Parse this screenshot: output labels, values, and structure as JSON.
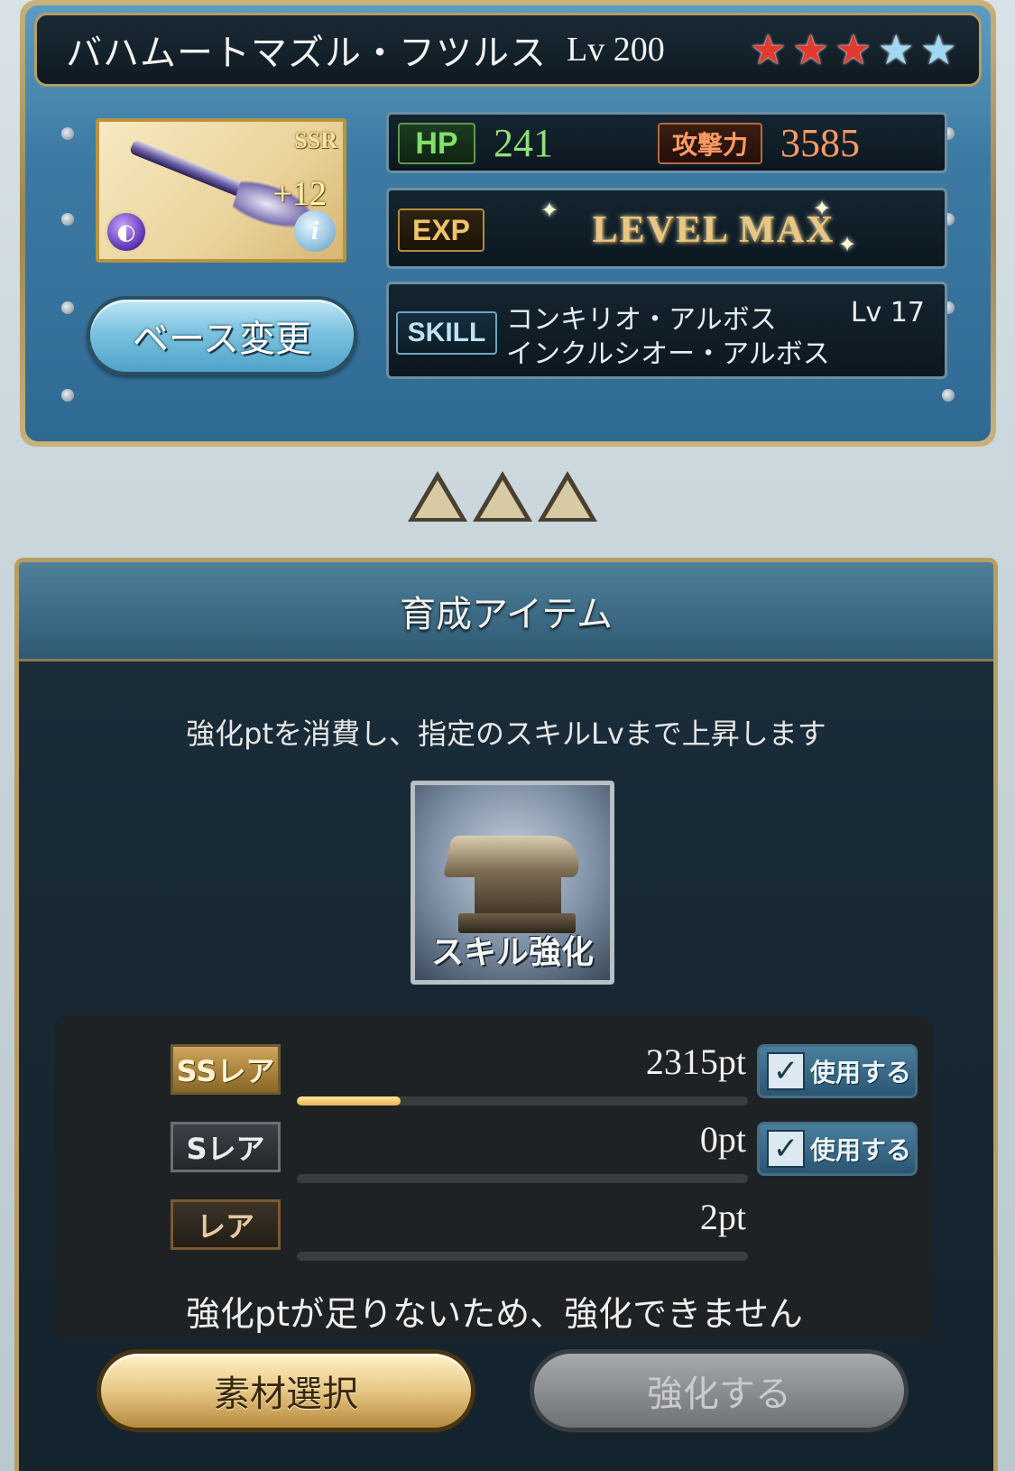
{
  "weapon": {
    "name": "バハムートマズル・フツルス",
    "level": "Lv 200",
    "stars_filled": 3,
    "stars_total": 5,
    "rarity": "SSR",
    "plus": "+12",
    "hp_label": "HP",
    "hp": "241",
    "atk_label": "攻撃力",
    "atk": "3585",
    "exp_label": "EXP",
    "exp_status": "LEVEL MAX",
    "skill_label": "SKILL",
    "skill_1": "コンキリオ・アルボス",
    "skill_2": "インクルシオー・アルボス",
    "skill_lv": "Lv  17",
    "base_change": "ベース変更",
    "element_icon": "dark-element-icon",
    "info_icon": "info-icon"
  },
  "panel": {
    "title": "育成アイテム",
    "description": "強化ptを消費し、指定のスキルLvまで上昇します",
    "item_label": "スキル強化",
    "rows": [
      {
        "rarity": "SSレア",
        "points": "2315pt",
        "progress": 0.23,
        "use_label": "使用する"
      },
      {
        "rarity": "Sレア",
        "points": "0pt",
        "progress": 0,
        "use_label": "使用する"
      },
      {
        "rarity": "レア",
        "points": "2pt",
        "progress": 0
      }
    ],
    "warning": "強化ptが足りないため、強化できません",
    "material_button": "素材選択",
    "enhance_button": "強化する"
  },
  "colors": {
    "star_filled": "#e23a2e",
    "star_empty": "#9fd7f5",
    "hp": "#8fe07a",
    "atk": "#ff9a62"
  }
}
